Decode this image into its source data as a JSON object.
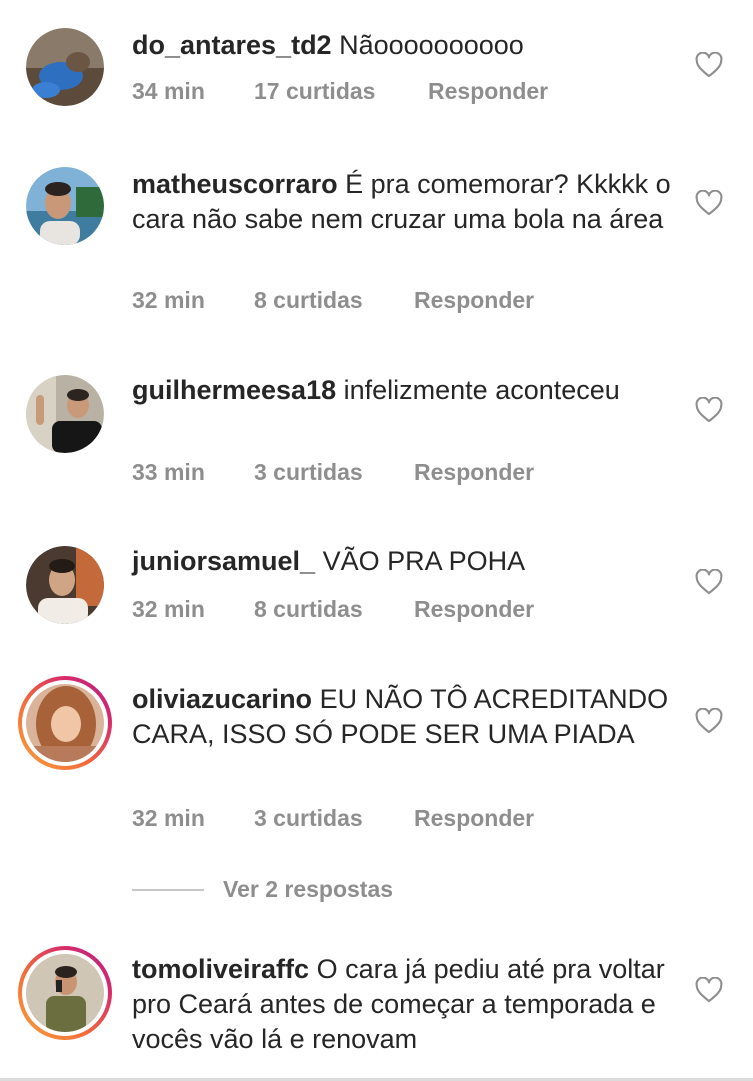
{
  "colors": {
    "text": "#262626",
    "meta": "#8e8e8e",
    "story_ring_start": "#f9a33a",
    "story_ring_end": "#b31f8a"
  },
  "comments": [
    {
      "username": "do_antares_td2",
      "text": "Nãoooooooooo",
      "time": "34 min",
      "likes": "17 curtidas",
      "reply": "Responder",
      "story_ring": false
    },
    {
      "username": "matheuscorraro",
      "text": "É pra comemorar? Kkkkk o cara não sabe nem cruzar uma bola na área",
      "time": "32 min",
      "likes": "8 curtidas",
      "reply": "Responder",
      "story_ring": false
    },
    {
      "username": "guilhermeesa18",
      "text": "infelizmente aconteceu",
      "time": "33 min",
      "likes": "3 curtidas",
      "reply": "Responder",
      "story_ring": false
    },
    {
      "username": "juniorsamuel_",
      "text": "VÃO PRA POHA",
      "time": "32 min",
      "likes": "8 curtidas",
      "reply": "Responder",
      "story_ring": false
    },
    {
      "username": "oliviazucarino",
      "text": "EU NÃO TÔ ACREDITANDO CARA, ISSO SÓ PODE SER UMA PIADA",
      "time": "32 min",
      "likes": "3 curtidas",
      "reply": "Responder",
      "story_ring": true
    },
    {
      "username": "tomoliveiraffc",
      "text": "O cara já pediu até pra voltar pro Ceará antes de começar a temporada e vocês vão lá e renovam",
      "story_ring": true
    }
  ],
  "view_replies": "Ver 2 respostas"
}
